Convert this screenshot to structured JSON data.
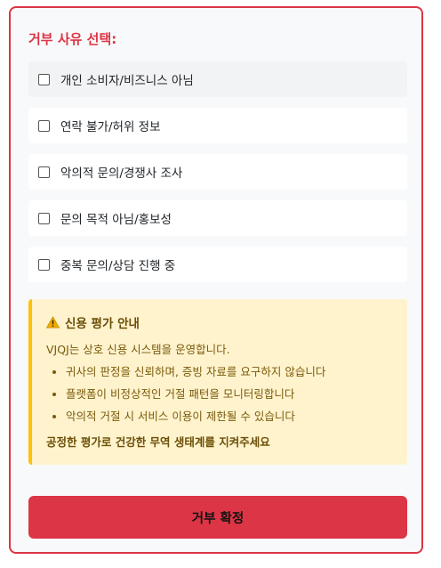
{
  "title": "거부 사유 선택:",
  "options": [
    {
      "label": "개인 소비자/비즈니스 아님"
    },
    {
      "label": "연락 불가/허위 정보"
    },
    {
      "label": "악의적 문의/경쟁사 조사"
    },
    {
      "label": "문의 목적 아님/홍보성"
    },
    {
      "label": "중복 문의/상담 진행 중"
    }
  ],
  "notice": {
    "icon": "warning-icon",
    "heading": "신용 평가 안내",
    "intro": "VJQJ는 상호 신용 시스템을 운영합니다.",
    "bullets": [
      "귀사의 판정을 신뢰하며, 증빙 자료를 요구하지 않습니다",
      "플랫폼이 비정상적인 거절 패턴을 모니터링합니다",
      "악의적 거절 시 서비스 이용이 제한될 수 있습니다"
    ],
    "footer": "공정한 평가로 건강한 무역 생태계를 지켜주세요"
  },
  "confirm_button": "거부 확정",
  "colors": {
    "accent": "#dc3545",
    "notice_bg": "#fff3cd",
    "notice_border": "#ffc107"
  }
}
